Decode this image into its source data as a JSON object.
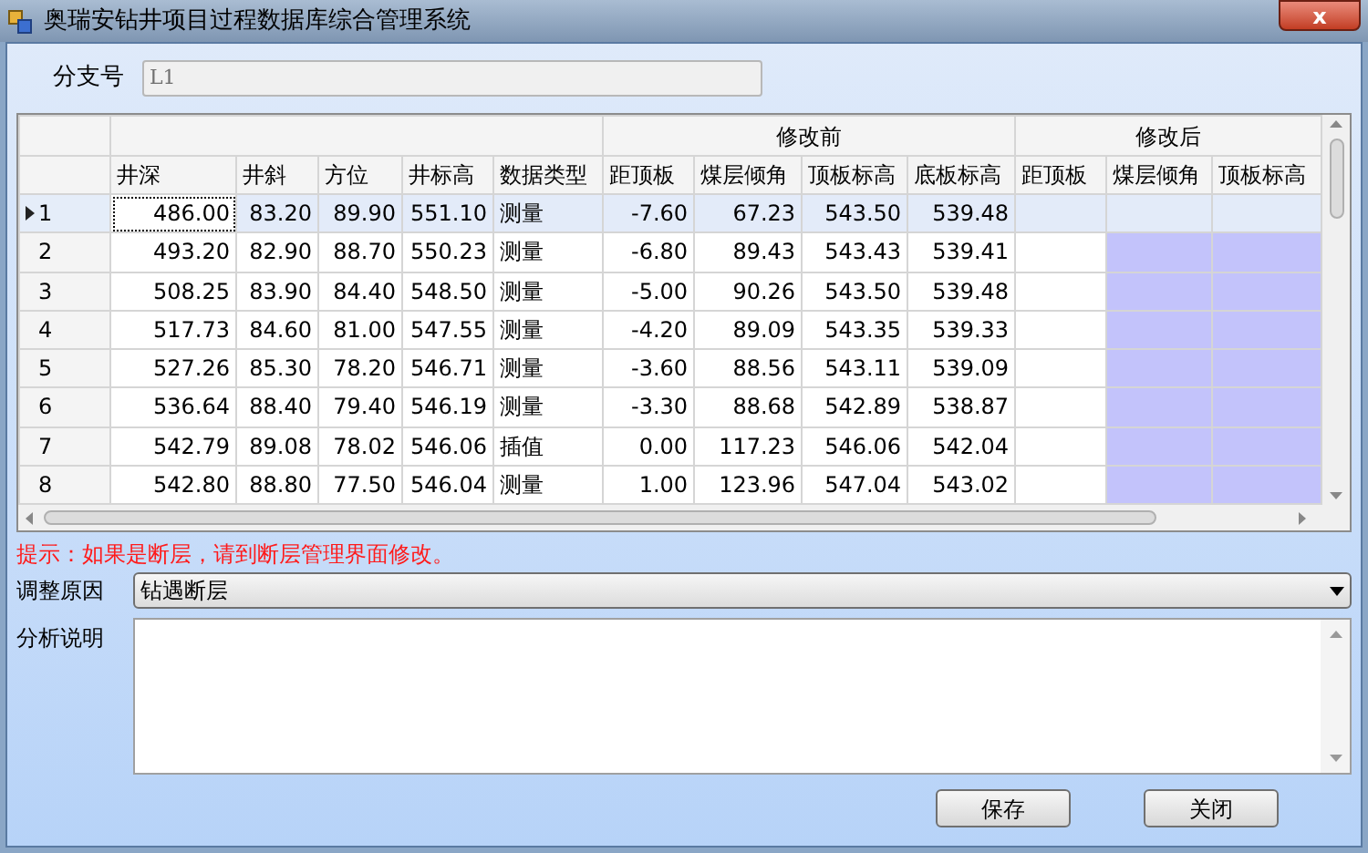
{
  "window": {
    "title": "奥瑞安钻井项目过程数据库综合管理系统",
    "close": "x"
  },
  "branch": {
    "label": "分支号",
    "value": "L1"
  },
  "table": {
    "column_groups": [
      {
        "columns": [
          {
            "label": "井深",
            "highlighted": false
          },
          {
            "label": "井斜",
            "highlighted": false
          },
          {
            "label": "方位",
            "highlighted": false
          },
          {
            "label": "井标高",
            "highlighted": false
          },
          {
            "label": "数据类型",
            "highlighted": false
          }
        ]
      },
      {
        "label": "修改前",
        "columns": [
          {
            "label": "距顶板",
            "highlighted": false
          },
          {
            "label": "煤层倾角",
            "highlighted": false
          },
          {
            "label": "顶板标高",
            "highlighted": false
          },
          {
            "label": "底板标高",
            "highlighted": false
          }
        ]
      },
      {
        "label": "修改后",
        "columns": [
          {
            "label": "距顶板",
            "highlighted": false
          },
          {
            "label": "煤层倾角",
            "highlighted": true
          },
          {
            "label": "顶板标高",
            "highlighted": true
          }
        ]
      }
    ],
    "rows": [
      {
        "number": "1",
        "selected": true,
        "cells": [
          "486.00",
          "83.20",
          "89.90",
          "551.10",
          "测量",
          "-7.60",
          "67.23",
          "543.50",
          "539.48"
        ]
      },
      {
        "number": "2",
        "selected": false,
        "cells": [
          "493.20",
          "82.90",
          "88.70",
          "550.23",
          "测量",
          "-6.80",
          "89.43",
          "543.43",
          "539.41"
        ]
      },
      {
        "number": "3",
        "selected": false,
        "cells": [
          "508.25",
          "83.90",
          "84.40",
          "548.50",
          "测量",
          "-5.00",
          "90.26",
          "543.50",
          "539.48"
        ]
      },
      {
        "number": "4",
        "selected": false,
        "cells": [
          "517.73",
          "84.60",
          "81.00",
          "547.55",
          "测量",
          "-4.20",
          "89.09",
          "543.35",
          "539.33"
        ]
      },
      {
        "number": "5",
        "selected": false,
        "cells": [
          "527.26",
          "85.30",
          "78.20",
          "546.71",
          "测量",
          "-3.60",
          "88.56",
          "543.11",
          "539.09"
        ]
      },
      {
        "number": "6",
        "selected": false,
        "cells": [
          "536.64",
          "88.40",
          "79.40",
          "546.19",
          "测量",
          "-3.30",
          "88.68",
          "542.89",
          "538.87"
        ]
      },
      {
        "number": "7",
        "selected": false,
        "cells": [
          "542.79",
          "89.08",
          "78.02",
          "546.06",
          "插值",
          "0.00",
          "117.23",
          "546.06",
          "542.04"
        ]
      },
      {
        "number": "8",
        "selected": false,
        "cells": [
          "542.80",
          "88.80",
          "77.50",
          "546.04",
          "测量",
          "1.00",
          "123.96",
          "547.04",
          "543.02"
        ]
      }
    ]
  },
  "hint": "提示：如果是断层，请到断层管理界面修改。",
  "reason": {
    "label": "调整原因",
    "value": "钻遇断层"
  },
  "analysis": {
    "label": "分析说明"
  },
  "buttons": [
    "保存",
    "关闭"
  ]
}
